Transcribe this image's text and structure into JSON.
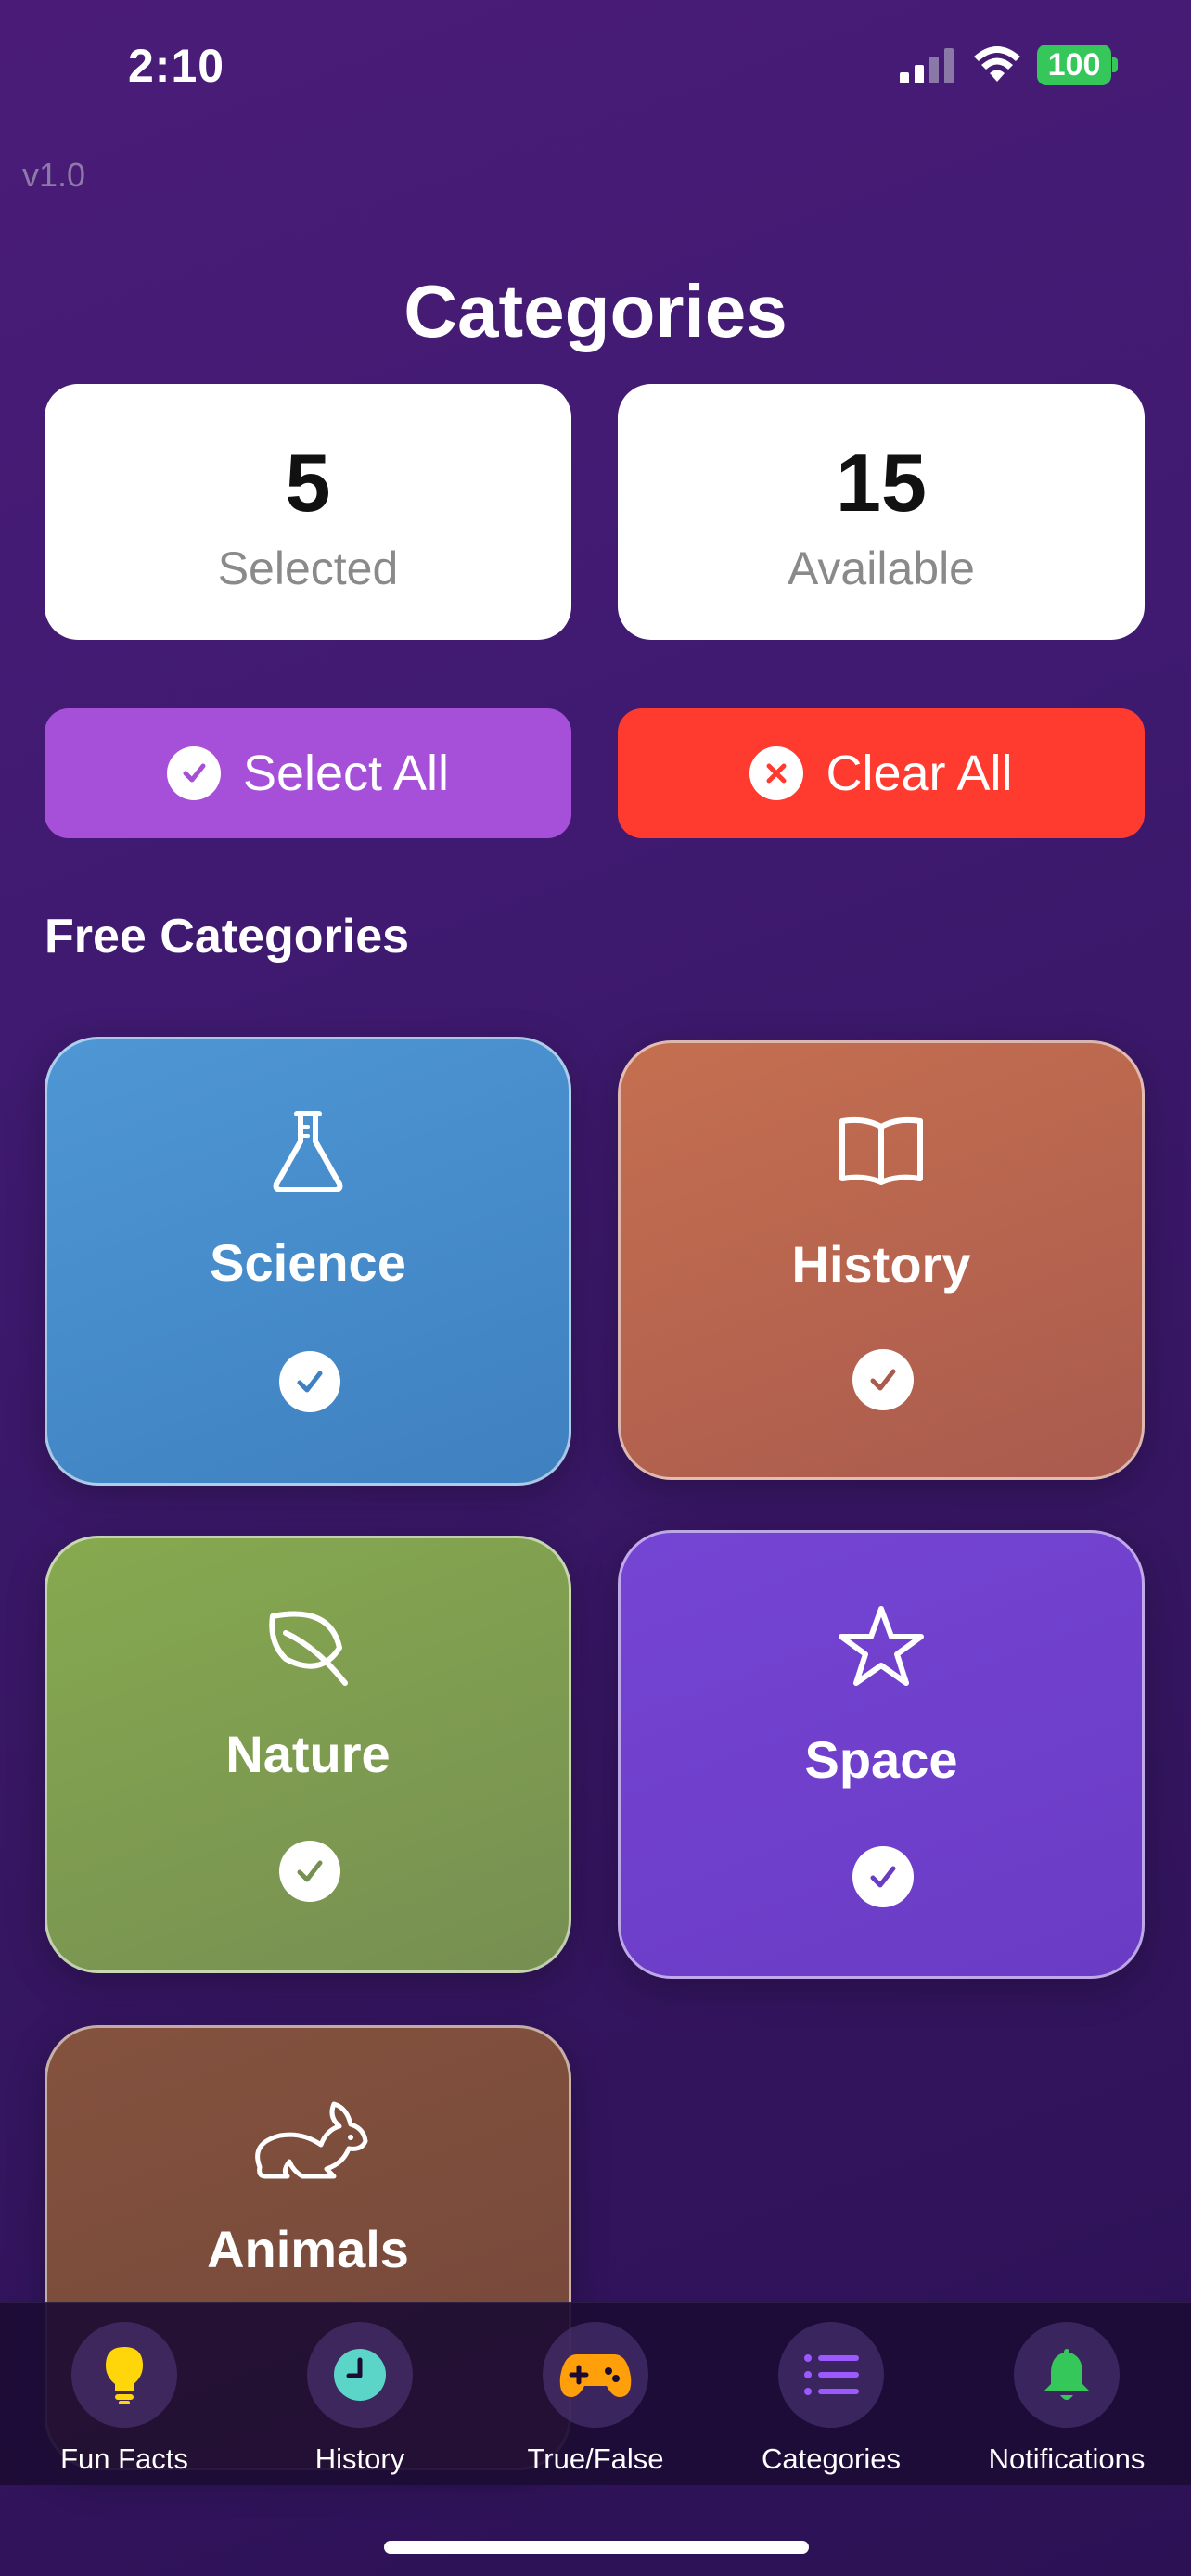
{
  "status_bar": {
    "time": "2:10",
    "battery": "100"
  },
  "app": {
    "version": "v1.0"
  },
  "page": {
    "title": "Categories"
  },
  "stats": {
    "selected_count": "5",
    "selected_label": "Selected",
    "available_count": "15",
    "available_label": "Available"
  },
  "actions": {
    "select_all": "Select All",
    "clear_all": "Clear All"
  },
  "section": {
    "title": "Free Categories"
  },
  "categories": [
    {
      "label": "Science",
      "icon": "flask-icon",
      "color": "#4a8fcb",
      "selected": true
    },
    {
      "label": "History",
      "icon": "book-icon",
      "color": "#b9634e",
      "selected": true
    },
    {
      "label": "Nature",
      "icon": "leaf-icon",
      "color": "#7c9b4e",
      "selected": true
    },
    {
      "label": "Space",
      "icon": "star-icon",
      "color": "#6b3ec8",
      "selected": true
    },
    {
      "label": "Animals",
      "icon": "rabbit-icon",
      "color": "#7a4a3a",
      "selected": true
    }
  ],
  "tabs": [
    {
      "label": "Fun Facts",
      "icon": "lightbulb-icon",
      "color": "#ffd60a"
    },
    {
      "label": "History",
      "icon": "clock-icon",
      "color": "#5ad5c8"
    },
    {
      "label": "True/False",
      "icon": "gamepad-icon",
      "color": "#ff9f0a"
    },
    {
      "label": "Categories",
      "icon": "list-icon",
      "color": "#9b59ff"
    },
    {
      "label": "Notifications",
      "icon": "bell-icon",
      "color": "#35c759"
    }
  ]
}
